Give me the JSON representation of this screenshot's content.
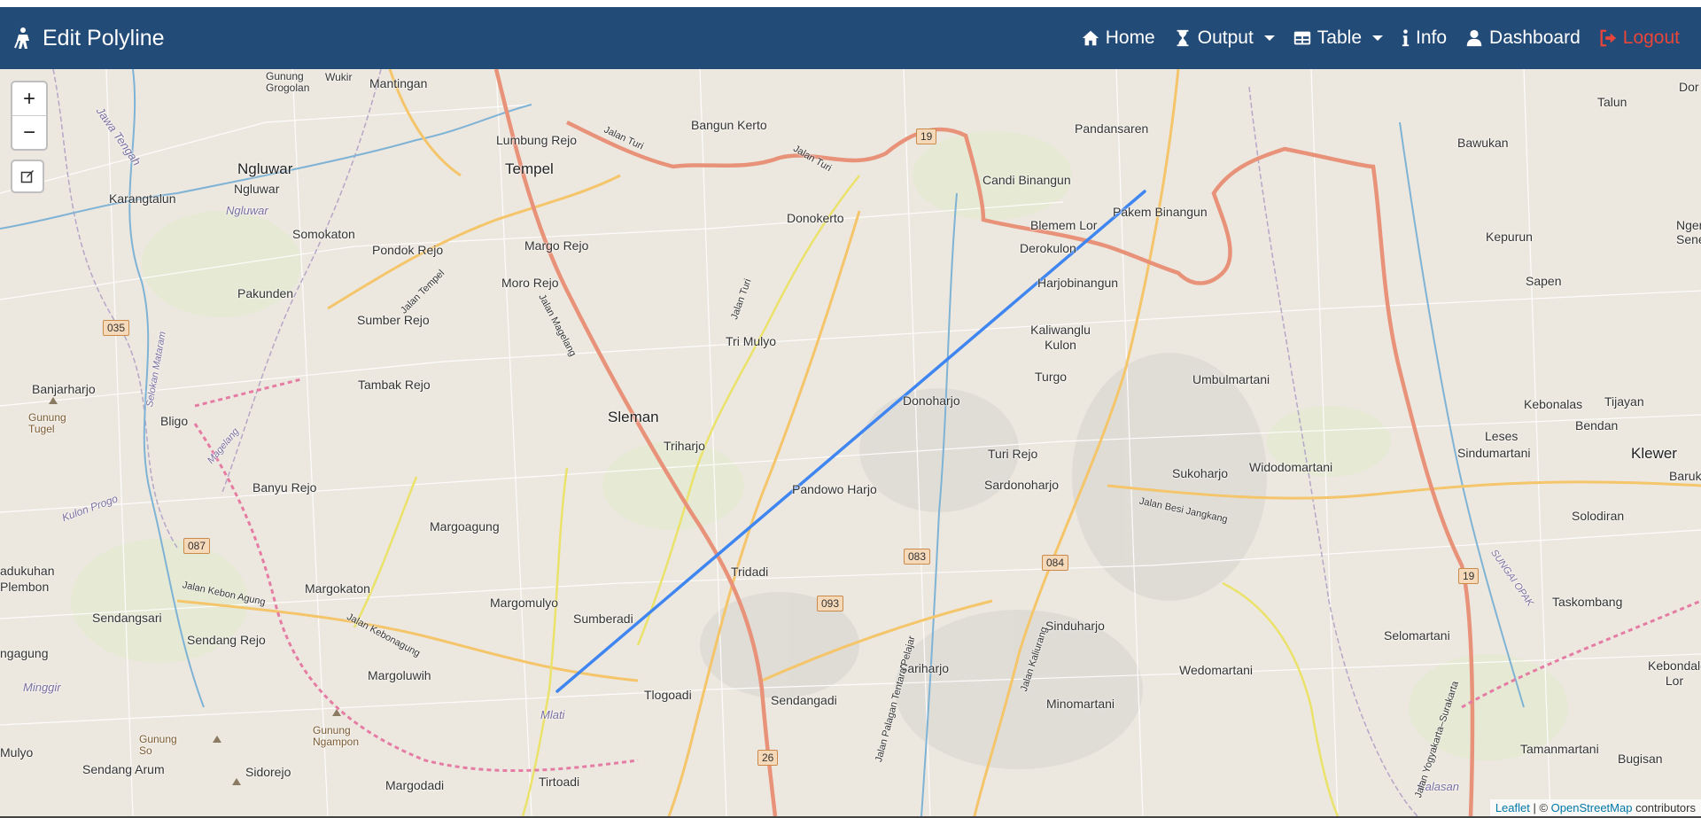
{
  "navbar": {
    "brand_title": "Edit Polyline",
    "items": [
      {
        "label": "Home",
        "icon": "home-icon"
      },
      {
        "label": "Output",
        "icon": "hourglass-icon",
        "dropdown": true
      },
      {
        "label": "Table",
        "icon": "table-icon",
        "dropdown": true
      },
      {
        "label": "Info",
        "icon": "info-icon"
      },
      {
        "label": "Dashboard",
        "icon": "user-icon"
      },
      {
        "label": "Logout",
        "icon": "logout-icon"
      }
    ],
    "colors": {
      "background": "#234b78",
      "logout": "#e8463a"
    }
  },
  "map": {
    "zoom_in_label": "+",
    "zoom_out_label": "−",
    "polyline_color": "#3f86f0",
    "attribution": {
      "leaflet": "Leaflet",
      "separator": " | © ",
      "osm": "OpenStreetMap",
      "suffix": " contributors"
    },
    "labels": {
      "gunung_grogolan": "Gunung Grogolan",
      "wukir": "Wukir",
      "mantingan": "Mantingan",
      "jawa_tengah": "Jawa Tengah",
      "ngluwar_big": "Ngluwar",
      "ngluwar": "Ngluwar",
      "ngluwar_it": "Ngluwar",
      "karangtalun": "Karangtalun",
      "somokaton": "Somokaton",
      "pakunden": "Pakunden",
      "banjarharjo": "Banjarharjo",
      "gunung_tugel": "Gunung Tugel",
      "bligo": "Bligo",
      "banyu_rejo": "Banyu Rejo",
      "adukuhan": "adukuhan",
      "plembon": "Plembon",
      "sendangsari": "Sendangsari",
      "sendang_rejo": "Sendang Rejo",
      "ngagung": "ngagung",
      "minggir": "Minggir",
      "mulyo": "Mulyo",
      "sendang_arum": "Sendang Arum",
      "gunung_so": "Gunung So",
      "gunung_ngampon": "Gunung Ngampon",
      "sidorejo": "Sidorejo",
      "margodadi": "Margodadi",
      "margoluwih": "Margoluwih",
      "margomulyo": "Margomulyo",
      "margokaton": "Margokaton",
      "margoagung": "Margoagung",
      "tambak_rejo": "Tambak Rejo",
      "sumber_rejo": "Sumber Rejo",
      "pondok_rejo": "Pondok Rejo",
      "moro_rejo": "Moro Rejo",
      "margo_rejo": "Margo Rejo",
      "lumbung_rejo": "Lumbung Rejo",
      "tempel": "Tempel",
      "bangun_kerto": "Bangun Kerto",
      "donokerto": "Donokerto",
      "tri_mulyo": "Tri Mulyo",
      "sleman": "Sleman",
      "triharjo": "Triharjo",
      "pandowo_harjo": "Pandowo Harjo",
      "tridadi": "Tridadi",
      "sumberadi": "Sumberadi",
      "tlogoadi": "Tlogoadi",
      "tirtoadi": "Tirtoadi",
      "mlati": "Mlati",
      "sendangadi": "Sendangadi",
      "sariharjo": "Sariharjo",
      "donoharjo": "Donoharjo",
      "turi_rejo": "Turi Rejo",
      "sardonoharjo": "Sardonoharjo",
      "sinduharjo": "Sinduharjo",
      "minomartani": "Minomartani",
      "turgo": "Turgo",
      "kaliwanglu_kulon": "Kaliwanglu Kulon",
      "harjobinangun": "Harjobinangun",
      "derokulon": "Derokulon",
      "blemem_lor": "Blemem Lor",
      "candi_binangun": "Candi Binangun",
      "pandansaren": "Pandansaren",
      "pakem_binangun": "Pakem Binangun",
      "umbulmartani": "Umbulmartani",
      "sukoharjo": "Sukoharjo",
      "widodomartani": "Widodomartani",
      "wedomartani": "Wedomartani",
      "talun": "Talun",
      "bawukan": "Bawukan",
      "kepurun": "Kepurun",
      "sapen": "Sapen",
      "ngemplak_seneng": "Ngempla Seneng",
      "leses": "Leses",
      "sindumartani": "Sindumartani",
      "kebonalas": "Kebonalas",
      "tijayan": "Tijayan",
      "bendan": "Bendan",
      "klewer": "Klewer",
      "baruk": "Baruk",
      "solodiran": "Solodiran",
      "taskombang": "Taskombang",
      "selomartani": "Selomartani",
      "kebondalem_lor": "Kebondalem Lor",
      "tamanmartani": "Tamanmartani",
      "bugisan": "Bugisan",
      "kalasan": "Kalasan",
      "dor": "Dor"
    },
    "roads": {
      "jalan_turi_1": "Jalan Turi",
      "jalan_turi_2": "Jalan Turi",
      "jalan_turi_3": "Jalan Turi",
      "jalan_magelang": "Jalan Magelang",
      "jalan_tempel": "Jalan Tempel",
      "jalan_kebon_agung": "Jalan Kebon Agung",
      "jalan_kebonagung": "Jalan Kebonagung",
      "jalan_kaliurang": "Jalan Kaliurang",
      "jalan_besi_jangkang": "Jalan Besi Jangkang",
      "selokan_mataram": "Selokan Mataram",
      "kulon_progo": "Kulon Progo",
      "sungai_opak": "SUNGAI OPAK",
      "magelang": "Magelang",
      "jalan_palagan": "Jalan Palagan Tentara Pelajar",
      "jalan_yogyakarta_surakarta": "Jalan Yogyakarta–Surakarta"
    },
    "shields": {
      "s19a": "19",
      "s035": "035",
      "s087": "087",
      "s083": "083",
      "s084": "084",
      "s093": "093",
      "s26": "26",
      "s19b": "19"
    }
  }
}
